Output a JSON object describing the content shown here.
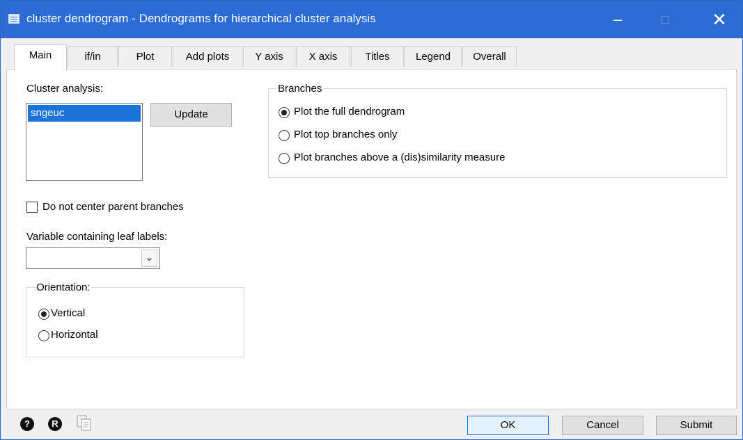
{
  "window": {
    "title": "cluster dendrogram - Dendrograms for hierarchical cluster analysis",
    "controls": {
      "minimize": "–",
      "maximize": "□",
      "close": "✕"
    }
  },
  "tabs": [
    {
      "label": "Main",
      "active": true
    },
    {
      "label": "if/in"
    },
    {
      "label": "Plot"
    },
    {
      "label": "Add plots"
    },
    {
      "label": "Y axis"
    },
    {
      "label": "X axis"
    },
    {
      "label": "Titles"
    },
    {
      "label": "Legend"
    },
    {
      "label": "Overall"
    }
  ],
  "main": {
    "cluster_label": "Cluster analysis:",
    "cluster_items": [
      "sngeuc"
    ],
    "update_button": "Update",
    "no_center_label": "Do not center parent branches",
    "no_center_checked": false,
    "leaf_label_label": "Variable containing leaf labels:",
    "leaf_label_value": "",
    "orientation": {
      "title": "Orientation:",
      "options": [
        "Vertical",
        "Horizontal"
      ],
      "selected": "Vertical"
    },
    "branches": {
      "title": "Branches",
      "options": [
        "Plot the full dendrogram",
        "Plot top branches only",
        "Plot branches above a (dis)similarity measure"
      ],
      "selected": "Plot the full dendrogram"
    }
  },
  "footer": {
    "help_icon": "?",
    "reset_icon": "R",
    "ok": "OK",
    "cancel": "Cancel",
    "submit": "Submit"
  }
}
